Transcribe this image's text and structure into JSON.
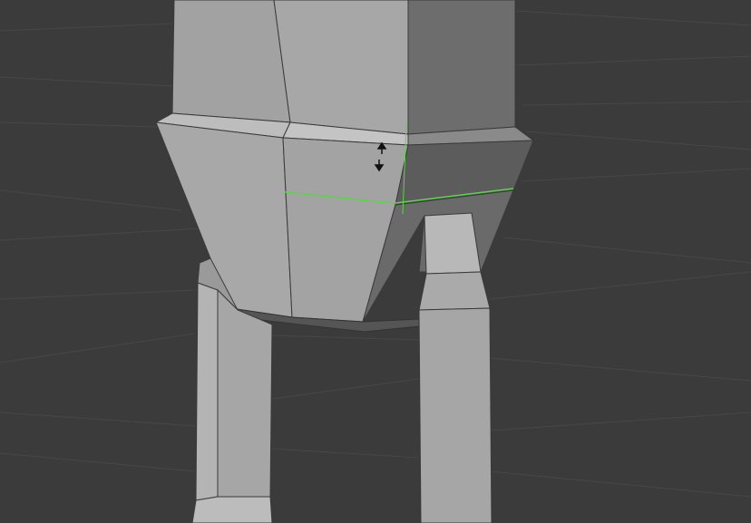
{
  "viewport": {
    "background_color": "#3b3b3b",
    "grid_color": "#454545",
    "mesh_colors": {
      "light": "#aeaeae",
      "mid": "#9d9d9d",
      "dark": "#6b6b6b",
      "darker": "#595959",
      "edge": "#2f2f2f"
    },
    "loop_cut_color": "#5bd34a",
    "cursor_icon": "move-up-down-arrows-icon"
  }
}
